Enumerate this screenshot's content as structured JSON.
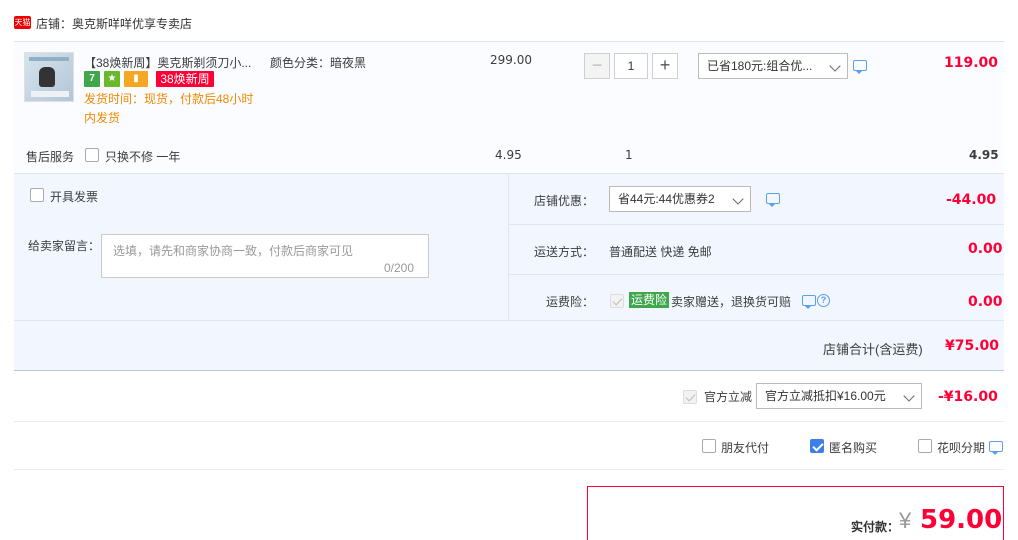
{
  "shop": {
    "badge": "天猫",
    "name": "店铺：奥克斯咩咩优享专卖店"
  },
  "item": {
    "title": "【38焕新周】奥克斯剃须刀小...",
    "sku": "颜色分类：暗夜黑",
    "badges": [
      "7",
      "",
      "",
      "38焕新周"
    ],
    "ship_time": "发货时间：现货，付款后48小时内发货",
    "unit_price": "299.00",
    "qty": "1",
    "promo": "已省180元:组合优...",
    "subtotal": "119.00"
  },
  "service": {
    "label": "售后服务",
    "option": "只换不修 一年",
    "price": "4.95",
    "qty": "1",
    "subtotal": "4.95"
  },
  "invoice": {
    "label": "开具发票"
  },
  "message": {
    "label": "给卖家留言：",
    "placeholder": "选填，请先和商家协商一致，付款后商家可见",
    "count": "0/200"
  },
  "shop_coupon": {
    "label": "店铺优惠：",
    "value": "省44元:44优惠券2",
    "amount": "-44.00"
  },
  "shipping": {
    "label": "运送方式：",
    "value": "普通配送 快递 免邮",
    "amount": "0.00"
  },
  "insurance": {
    "label": "运费险：",
    "tag": "运费险",
    "text": "卖家赠送，退换货可赔",
    "amount": "0.00"
  },
  "shop_total": {
    "label": "店铺合计(含运费)",
    "amount": "¥75.00"
  },
  "official": {
    "label": "官方立减",
    "value": "官方立减抵扣¥16.00元",
    "amount": "-¥16.00"
  },
  "options": [
    {
      "label": "朋友代付",
      "checked": false
    },
    {
      "label": "匿名购买",
      "checked": true
    },
    {
      "label": "花呗分期",
      "checked": false
    }
  ],
  "payment": {
    "label": "实付款：",
    "currency": "¥",
    "amount": "59.00"
  },
  "colors": {
    "price_red": "#ff0036",
    "accent_blue": "#3d7fea",
    "orange": "#f08a00"
  }
}
